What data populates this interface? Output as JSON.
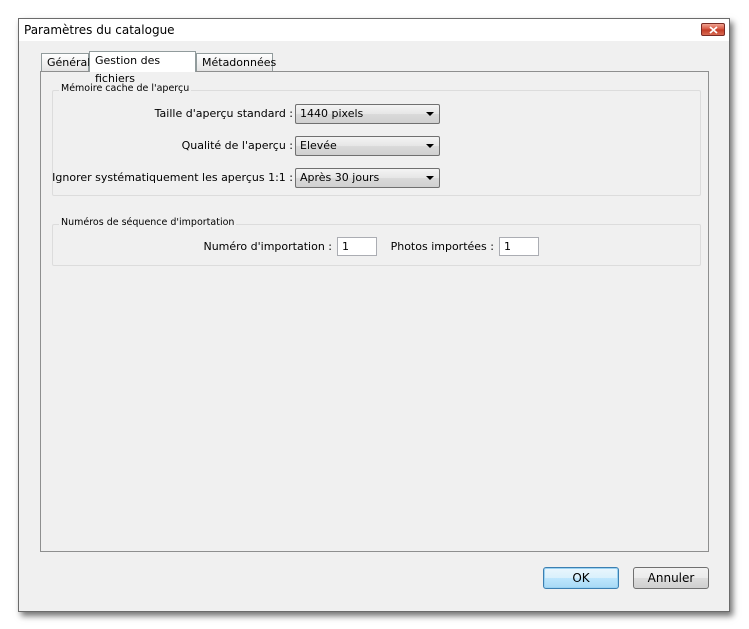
{
  "window": {
    "title": "Paramètres du catalogue"
  },
  "tabs": [
    {
      "label": "Général"
    },
    {
      "label": "Gestion des fichiers",
      "active": true
    },
    {
      "label": "Métadonnées"
    }
  ],
  "preview_cache": {
    "group_label": "Mémoire cache de l'aperçu",
    "standard_size_label": "Taille d'aperçu standard :",
    "standard_size_value": "1440 pixels",
    "quality_label": "Qualité de l'aperçu :",
    "quality_value": "Elevée",
    "discard_label": "Ignorer systématiquement les aperçus 1:1 :",
    "discard_value": "Après 30 jours"
  },
  "import_sequence": {
    "group_label": "Numéros de séquence d'importation",
    "import_number_label": "Numéro d'importation :",
    "import_number_value": "1",
    "photos_imported_label": "Photos importées :",
    "photos_imported_value": "1"
  },
  "buttons": {
    "ok": "OK",
    "cancel": "Annuler"
  },
  "colors": {
    "default_button_border": "#3c7fb1",
    "close_button": "#c13a25"
  },
  "icons": {
    "close": "close-icon",
    "dropdown": "chevron-down-icon"
  }
}
